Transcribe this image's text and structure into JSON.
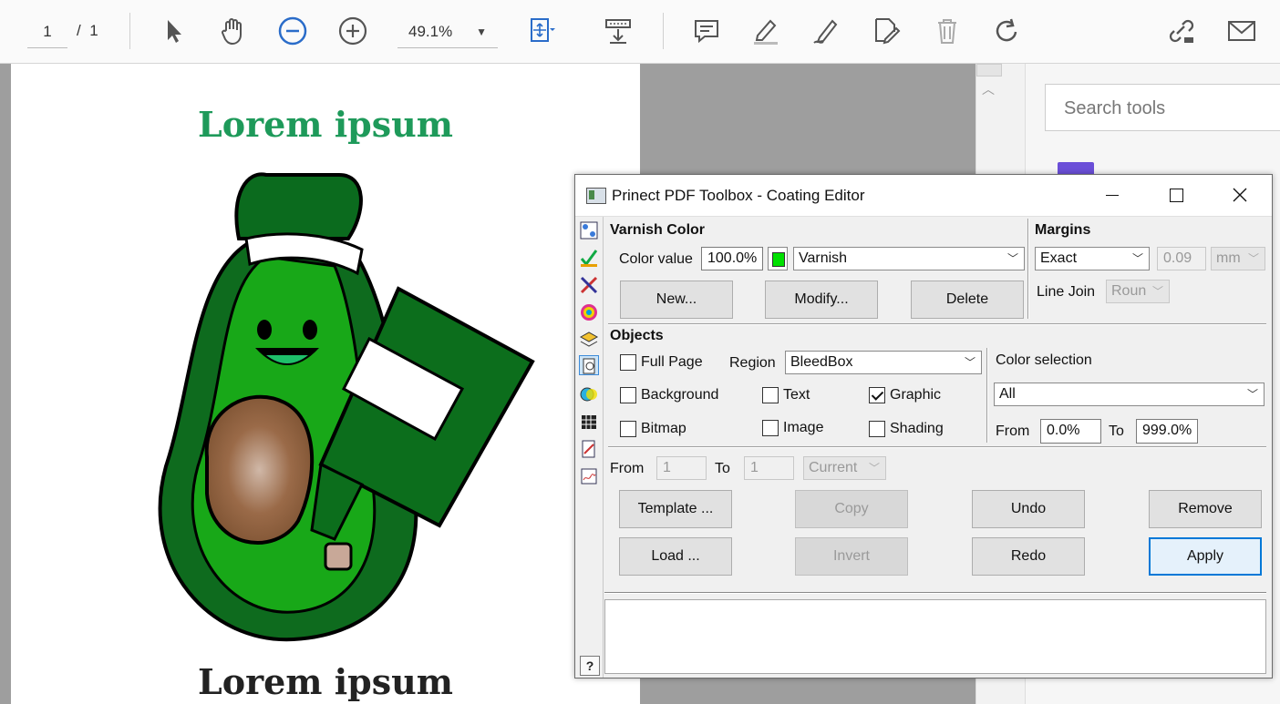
{
  "toolbar": {
    "page_current": "1",
    "page_separator": "/",
    "page_total": "1",
    "zoom_value": "49.1%"
  },
  "document": {
    "title_top": "Lorem ipsum",
    "title_bottom": "Lorem ipsum",
    "title_top_color": "#1e9a5a"
  },
  "right_pane": {
    "search_placeholder": "Search tools"
  },
  "dialog": {
    "title": "Prinect PDF Toolbox - Coating Editor",
    "varnish": {
      "heading": "Varnish Color",
      "color_value_label": "Color value",
      "color_value": "100.0%",
      "swatch_color": "#00e000",
      "color_name": "Varnish",
      "new_button": "New...",
      "modify_button": "Modify...",
      "delete_button": "Delete"
    },
    "margins": {
      "heading": "Margins",
      "mode": "Exact",
      "value": "0.09",
      "unit": "mm",
      "line_join_label": "Line Join",
      "line_join_value": "Roun"
    },
    "objects": {
      "heading": "Objects",
      "full_page": "Full Page",
      "region_label": "Region",
      "region_value": "BleedBox",
      "background": "Background",
      "text": "Text",
      "graphic": "Graphic",
      "bitmap": "Bitmap",
      "image": "Image",
      "shading": "Shading"
    },
    "color_selection": {
      "label": "Color selection",
      "value": "All",
      "from_label": "From",
      "from_value": "0.0%",
      "to_label": "To",
      "to_value": "999.0%"
    },
    "pages": {
      "from_label": "From",
      "from_value": "1",
      "to_label": "To",
      "to_value": "1",
      "scope": "Current"
    },
    "buttons": {
      "template": "Template ...",
      "copy": "Copy",
      "undo": "Undo",
      "remove": "Remove",
      "load": "Load ...",
      "invert": "Invert",
      "redo": "Redo",
      "apply": "Apply"
    },
    "help_label": "?"
  }
}
